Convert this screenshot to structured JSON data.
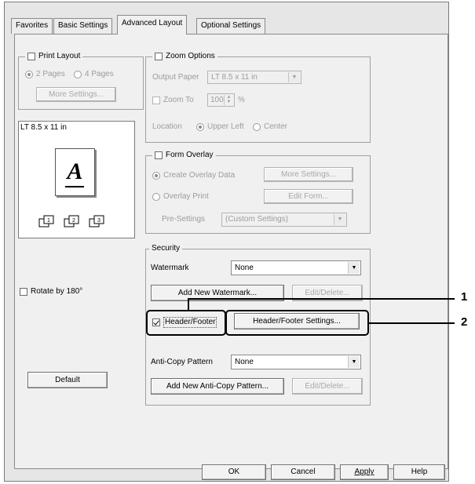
{
  "tabs": [
    {
      "label": "Favorites"
    },
    {
      "label": "Basic Settings"
    },
    {
      "label": "Advanced Layout",
      "active": true
    },
    {
      "label": "Optional Settings"
    }
  ],
  "print_layout": {
    "title": "Print Layout",
    "checked": false,
    "option_2pages": "2 Pages",
    "option_4pages": "4 Pages",
    "more_settings": "More Settings..."
  },
  "preview": {
    "paper_label": "LT 8.5 x 11 in",
    "letter": "A"
  },
  "rotate": {
    "label": "Rotate by 180°",
    "checked": false
  },
  "default_button": "Default",
  "zoom_options": {
    "title": "Zoom Options",
    "checked": false,
    "output_paper_label": "Output Paper",
    "output_paper_value": "LT 8.5 x 11 in",
    "zoom_to_label": "Zoom To",
    "zoom_value": "100",
    "zoom_unit": "%",
    "location_label": "Location",
    "upper_left": "Upper Left",
    "center": "Center"
  },
  "form_overlay": {
    "title": "Form Overlay",
    "checked": false,
    "create_overlay": "Create Overlay Data",
    "more_settings": "More Settings...",
    "overlay_print": "Overlay Print",
    "edit_form": "Edit Form...",
    "pre_settings_label": "Pre-Settings",
    "pre_settings_value": "(Custom Settings)"
  },
  "security": {
    "title": "Security",
    "watermark_label": "Watermark",
    "watermark_value": "None",
    "add_watermark": "Add New Watermark...",
    "edit_delete_1": "Edit/Delete...",
    "header_footer_label": "Header/Footer",
    "header_footer_checked": true,
    "header_footer_settings": "Header/Footer Settings...",
    "anticopy_label": "Anti-Copy Pattern",
    "anticopy_value": "None",
    "add_anticopy": "Add New Anti-Copy Pattern...",
    "edit_delete_2": "Edit/Delete..."
  },
  "footer": {
    "ok": "OK",
    "cancel": "Cancel",
    "apply": "Apply",
    "help": "Help"
  },
  "callouts": {
    "one": "1",
    "two": "2"
  }
}
